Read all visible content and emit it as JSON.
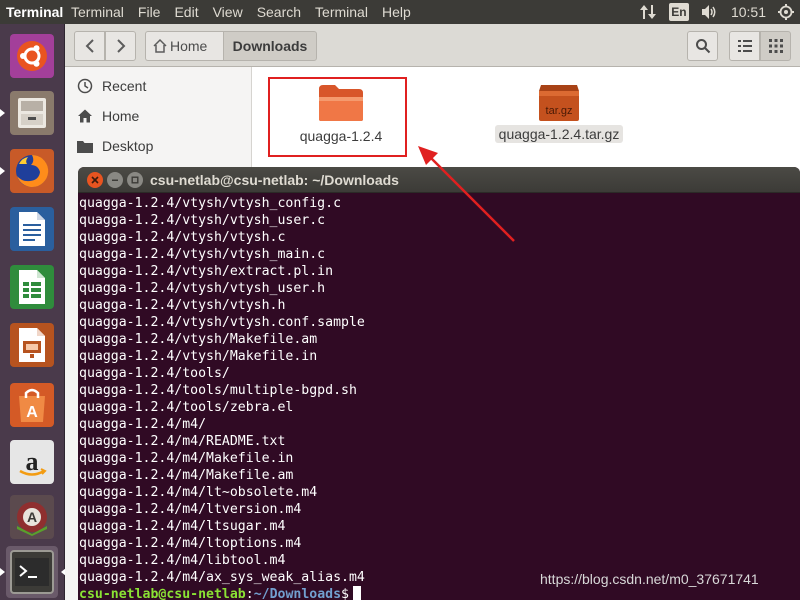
{
  "topbar": {
    "app_title": "Terminal",
    "menus": [
      "Terminal",
      "File",
      "Edit",
      "View",
      "Search",
      "Terminal",
      "Help"
    ],
    "keyboard_layout": "En",
    "time": "10:51"
  },
  "launcher": {
    "icons": [
      "ubuntu-icon",
      "file-cabinet-icon",
      "firefox-icon",
      "writer-icon",
      "calc-icon",
      "impress-icon",
      "software-center-icon",
      "amazon-icon",
      "updater-icon",
      "terminal-icon"
    ]
  },
  "files": {
    "breadcrumb": {
      "home": "Home",
      "current": "Downloads"
    },
    "sidebar": {
      "items": [
        {
          "label": "Recent",
          "icon": "clock-icon"
        },
        {
          "label": "Home",
          "icon": "home-icon"
        },
        {
          "label": "Desktop",
          "icon": "folder-icon"
        }
      ]
    },
    "items": [
      {
        "name": "quagga-1.2.4",
        "type": "folder",
        "color": "#f07746"
      },
      {
        "name": "quagga-1.2.4.tar.gz",
        "type": "archive",
        "badge": "tar.gz",
        "color": "#c4511e"
      }
    ]
  },
  "terminal": {
    "title": "csu-netlab@csu-netlab: ~/Downloads",
    "lines": [
      "quagga-1.2.4/vtysh/vtysh_config.c",
      "quagga-1.2.4/vtysh/vtysh_user.c",
      "quagga-1.2.4/vtysh/vtysh.c",
      "quagga-1.2.4/vtysh/vtysh_main.c",
      "quagga-1.2.4/vtysh/extract.pl.in",
      "quagga-1.2.4/vtysh/vtysh_user.h",
      "quagga-1.2.4/vtysh/vtysh.h",
      "quagga-1.2.4/vtysh/vtysh.conf.sample",
      "quagga-1.2.4/vtysh/Makefile.am",
      "quagga-1.2.4/vtysh/Makefile.in",
      "quagga-1.2.4/tools/",
      "quagga-1.2.4/tools/multiple-bgpd.sh",
      "quagga-1.2.4/tools/zebra.el",
      "quagga-1.2.4/m4/",
      "quagga-1.2.4/m4/README.txt",
      "quagga-1.2.4/m4/Makefile.in",
      "quagga-1.2.4/m4/Makefile.am",
      "quagga-1.2.4/m4/lt~obsolete.m4",
      "quagga-1.2.4/m4/ltversion.m4",
      "quagga-1.2.4/m4/ltsugar.m4",
      "quagga-1.2.4/m4/ltoptions.m4",
      "quagga-1.2.4/m4/libtool.m4",
      "quagga-1.2.4/m4/ax_sys_weak_alias.m4"
    ],
    "prompt": {
      "user_host": "csu-netlab@csu-netlab",
      "separator": ":",
      "path": "~/Downloads",
      "symbol": "$"
    },
    "colors": {
      "background": "#300a24",
      "prompt_user": "#8ae234",
      "prompt_path": "#729fcf"
    }
  },
  "watermark": "https://blog.csdn.net/m0_37671741",
  "annotation": {
    "highlight_color": "#e02020"
  }
}
